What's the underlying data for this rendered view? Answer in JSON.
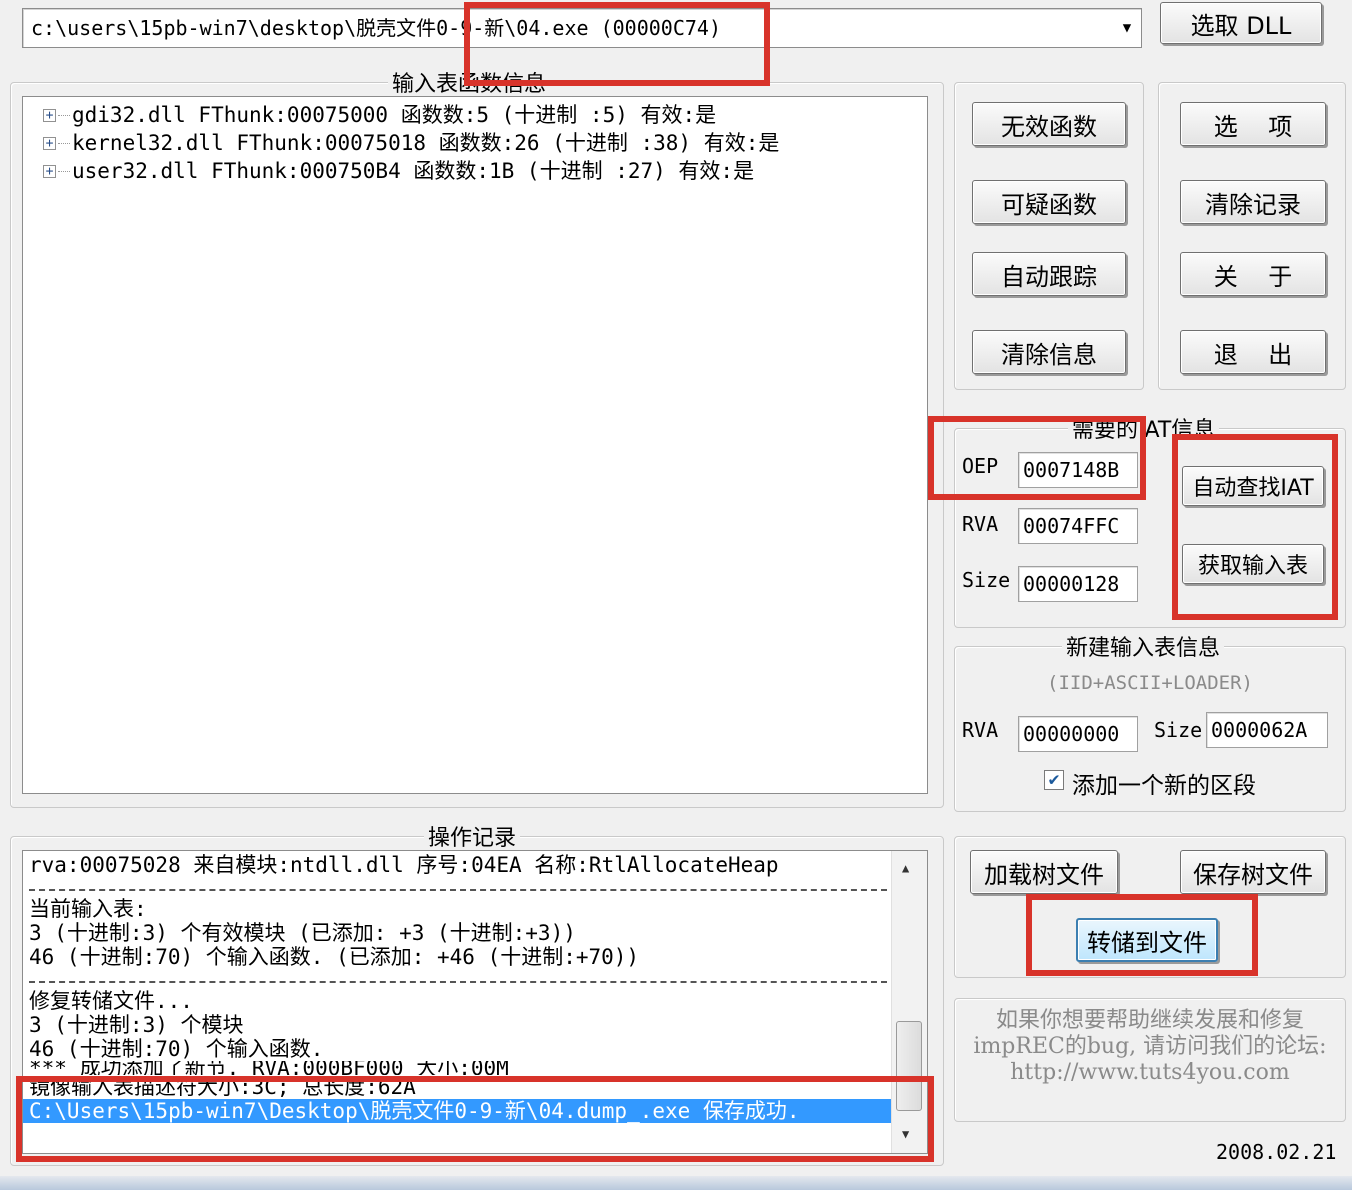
{
  "process_combo": {
    "value": "c:\\users\\15pb-win7\\desktop\\脱壳文件0-9-新\\04.exe  (00000C74)"
  },
  "select_dll_label": "选取 DLL",
  "imports_group": {
    "title": "输入表函数信息",
    "items": [
      {
        "text": "gdi32.dll FThunk:00075000 函数数:5 (十进制 :5) 有效:是"
      },
      {
        "text": "kernel32.dll FThunk:00075018 函数数:26 (十进制 :38) 有效:是"
      },
      {
        "text": "user32.dll FThunk:000750B4 函数数:1B (十进制 :27) 有效:是"
      }
    ]
  },
  "buttons_left": {
    "invalid": "无效函数",
    "suspect": "可疑函数",
    "auto_trace": "自动跟踪",
    "clear_info": "清除信息"
  },
  "buttons_right": {
    "options": "选    项",
    "clear_log": "清除记录",
    "about": "关    于",
    "exit": "退    出"
  },
  "iat_group": {
    "title": "需要的IAT信息",
    "oep_label": "OEP",
    "oep_value": "0007148B",
    "rva_label": "RVA",
    "rva_value": "00074FFC",
    "size_label": "Size",
    "size_value": "00000128",
    "auto_iat_button": "自动查找IAT",
    "get_imports_button": "获取输入表"
  },
  "new_import_group": {
    "title": "新建输入表信息",
    "subtitle": "(IID+ASCII+LOADER)",
    "rva_label": "RVA",
    "rva_value": "00000000",
    "size_label": "Size",
    "size_value": "0000062A",
    "add_section_label": "添加一个新的区段",
    "add_section_checked": true
  },
  "log_group": {
    "title": "操作记录",
    "lines": {
      "l0": "rva:00075028 来自模块:ntdll.dll 序号:04EA 名称:RtlAllocateHeap",
      "l1": "当前输入表:",
      "l2": "3 (十进制:3) 个有效模块 (已添加: +3 (十进制:+3))",
      "l3": "46 (十进制:70) 个输入函数. (已添加: +46 (十进制:+70))",
      "l4": "修复转储文件...",
      "l5": "3 (十进制:3) 个模块",
      "l6": "46 (十进制:70) 个输入函数.",
      "l7": "*** 成功添加了新节. RVA:000BF000 大小:00M",
      "l8": "镜像输入表描述符大小:3C; 总长度:62A",
      "l9": "C:\\Users\\15pb-win7\\Desktop\\脱壳文件0-9-新\\04.dump_.exe 保存成功."
    }
  },
  "tree_file_buttons": {
    "load": "加载树文件",
    "save": "保存树文件",
    "dump": "转储到文件"
  },
  "credits": {
    "line1": "如果你想要帮助继续发展和修复",
    "line2": "impREC的bug, 请访问我们的论坛:",
    "line3": "http://www.tuts4you.com"
  },
  "version_date": "2008.02.21",
  "colors": {
    "highlight_box": "#d8332a",
    "selection": "#3399ff"
  }
}
